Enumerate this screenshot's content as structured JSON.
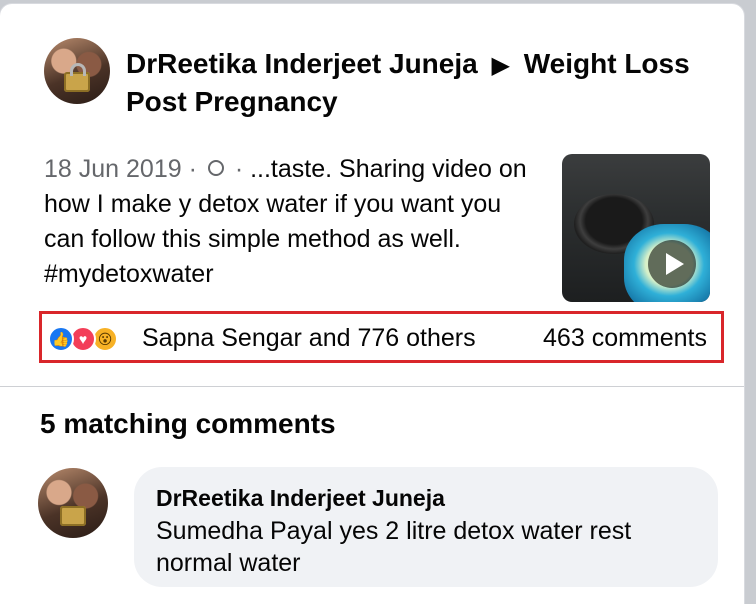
{
  "post": {
    "author": "DrReetika Inderjeet Juneja",
    "group_arrow": "▶",
    "group": "Weight Loss Post Pregnancy",
    "date": "18 Jun 2019 ·",
    "privacy_sep": "·",
    "text": "...taste. Sharing video on how I make y detox water if you want you can follow this simple method as well. #mydetoxwater",
    "privacy_icon": "group-icon",
    "thumbnail_icon": "play-icon"
  },
  "reactions": {
    "icons": [
      "like-icon",
      "love-icon",
      "wow-icon"
    ],
    "like_glyph": "👍",
    "love_glyph": "♥",
    "wow_glyph": "😮",
    "summary": "Sapna Sengar and 776 others",
    "comments": "463 comments",
    "highlight_color": "#d9262a"
  },
  "comments_section": {
    "heading": "5 matching comments",
    "items": [
      {
        "author": "DrReetika Inderjeet Juneja",
        "text": "Sumedha Payal yes 2 litre detox water rest normal water"
      }
    ]
  }
}
